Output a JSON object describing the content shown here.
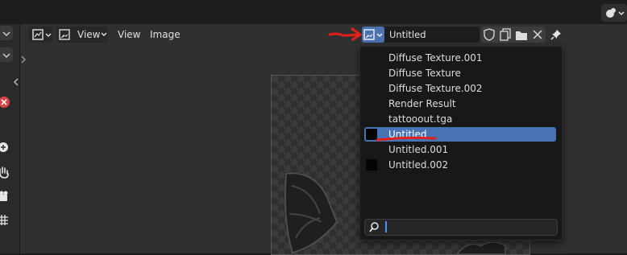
{
  "editor_header": {
    "view_menu": "View",
    "view_label": "View",
    "image_label": "Image"
  },
  "image_selector": {
    "current_name": "Untitled"
  },
  "dropdown": {
    "items": [
      {
        "label": "Diffuse Texture.001",
        "thumb": false,
        "selected": false
      },
      {
        "label": "Diffuse Texture",
        "thumb": false,
        "selected": false
      },
      {
        "label": "Diffuse Texture.002",
        "thumb": false,
        "selected": false
      },
      {
        "label": "Render Result",
        "thumb": false,
        "selected": false
      },
      {
        "label": "tattooout.tga",
        "thumb": false,
        "selected": false
      },
      {
        "label": "Untitled",
        "thumb": true,
        "selected": true
      },
      {
        "label": "Untitled.001",
        "thumb": false,
        "selected": false
      },
      {
        "label": "Untitled.002",
        "thumb": true,
        "selected": false
      }
    ],
    "search_value": ""
  },
  "colors": {
    "accent_blue": "#4772b3",
    "annotation_red": "#e3201b",
    "background": "#303030"
  },
  "icons": [
    "overlay-icon",
    "editor-type-icon",
    "chevron-down-icon",
    "image-icon",
    "shield-icon",
    "duplicate-icon",
    "folder-icon",
    "close-icon",
    "pin-icon",
    "search-icon",
    "zoom-icon",
    "hand-icon",
    "camera-icon",
    "grid-icon",
    "cancel-icon"
  ]
}
